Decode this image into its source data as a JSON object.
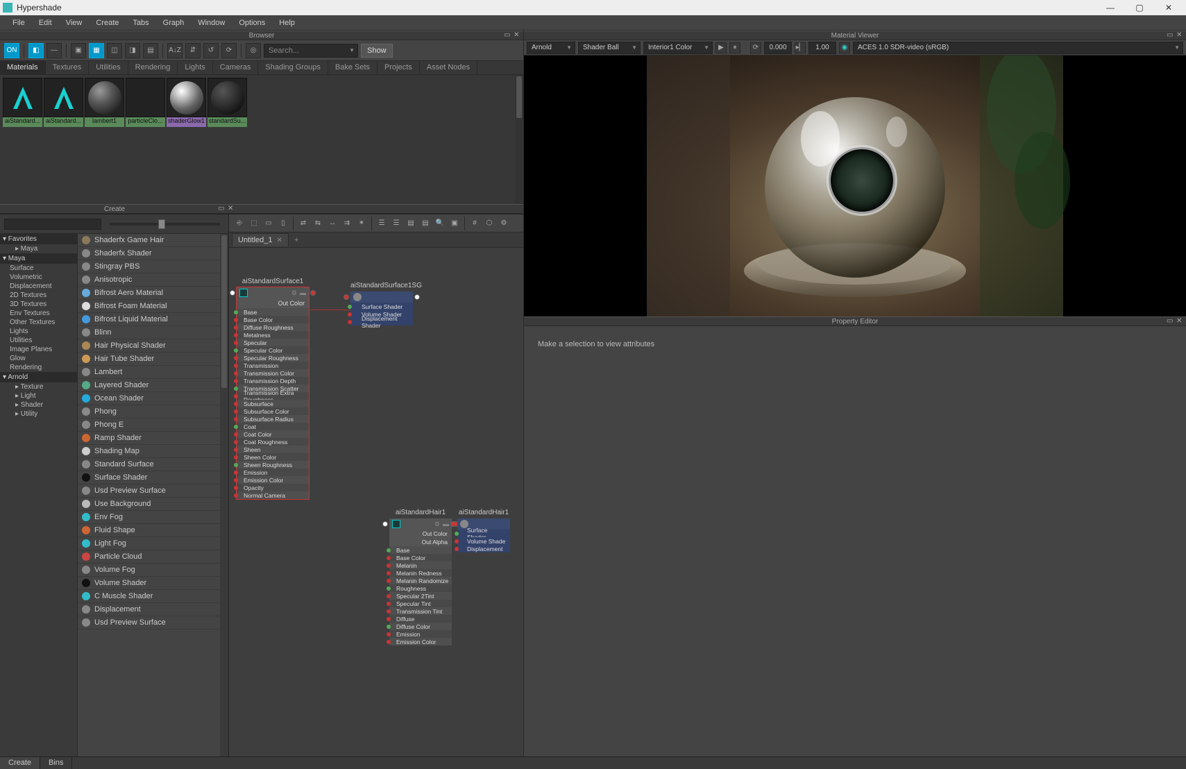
{
  "window": {
    "title": "Hypershade"
  },
  "menubar": [
    "File",
    "Edit",
    "View",
    "Create",
    "Tabs",
    "Graph",
    "Window",
    "Options",
    "Help"
  ],
  "panels": {
    "browser_title": "Browser",
    "create_title": "Create",
    "viewer_title": "Material Viewer",
    "property_title": "Property Editor"
  },
  "browser": {
    "search_placeholder": "Search...",
    "show_btn": "Show",
    "tabs": [
      "Materials",
      "Textures",
      "Utilities",
      "Rendering",
      "Lights",
      "Cameras",
      "Shading Groups",
      "Bake Sets",
      "Projects",
      "Asset Nodes"
    ],
    "active_tab": 0,
    "swatches": [
      {
        "label": "aiStandard...",
        "kind": "arnold"
      },
      {
        "label": "aiStandard...",
        "kind": "arnold"
      },
      {
        "label": "lambert1",
        "kind": "sphere"
      },
      {
        "label": "particleClo...",
        "kind": "checker"
      },
      {
        "label": "shaderGlow1",
        "kind": "glass",
        "selected": true
      },
      {
        "label": "standardSu...",
        "kind": "dark"
      }
    ]
  },
  "create": {
    "categories": [
      {
        "type": "hdr",
        "label": "Favorites"
      },
      {
        "type": "item",
        "label": "Maya",
        "indent": 1,
        "arrow": true
      },
      {
        "type": "hdr",
        "label": "Maya"
      },
      {
        "type": "item",
        "label": "Surface"
      },
      {
        "type": "item",
        "label": "Volumetric"
      },
      {
        "type": "item",
        "label": "Displacement"
      },
      {
        "type": "item",
        "label": "2D Textures"
      },
      {
        "type": "item",
        "label": "3D Textures"
      },
      {
        "type": "item",
        "label": "Env Textures"
      },
      {
        "type": "item",
        "label": "Other Textures"
      },
      {
        "type": "item",
        "label": "Lights"
      },
      {
        "type": "item",
        "label": "Utilities"
      },
      {
        "type": "item",
        "label": "Image Planes"
      },
      {
        "type": "item",
        "label": "Glow"
      },
      {
        "type": "item",
        "label": "Rendering"
      },
      {
        "type": "hdr",
        "label": "Arnold"
      },
      {
        "type": "item",
        "label": "Texture",
        "indent": 1,
        "arrow": true
      },
      {
        "type": "item",
        "label": "Light",
        "indent": 1,
        "arrow": true
      },
      {
        "type": "item",
        "label": "Shader",
        "indent": 1,
        "arrow": true
      },
      {
        "type": "item",
        "label": "Utility",
        "indent": 1,
        "arrow": true
      }
    ],
    "shaders": [
      {
        "label": "Shaderfx Game Hair",
        "color": "#8a7a5a"
      },
      {
        "label": "Shaderfx Shader",
        "color": "#888"
      },
      {
        "label": "Stingray PBS",
        "color": "#888"
      },
      {
        "label": "Anisotropic",
        "color": "#888"
      },
      {
        "label": "Bifrost Aero Material",
        "color": "#6ad"
      },
      {
        "label": "Bifrost Foam Material",
        "color": "#ddd"
      },
      {
        "label": "Bifrost Liquid Material",
        "color": "#49d"
      },
      {
        "label": "Blinn",
        "color": "#888"
      },
      {
        "label": "Hair Physical Shader",
        "color": "#a85"
      },
      {
        "label": "Hair Tube Shader",
        "color": "#c95"
      },
      {
        "label": "Lambert",
        "color": "#888"
      },
      {
        "label": "Layered Shader",
        "color": "#5a8"
      },
      {
        "label": "Ocean Shader",
        "color": "#2ad"
      },
      {
        "label": "Phong",
        "color": "#888"
      },
      {
        "label": "Phong E",
        "color": "#888"
      },
      {
        "label": "Ramp Shader",
        "color": "#c63"
      },
      {
        "label": "Shading Map",
        "color": "#ccc"
      },
      {
        "label": "Standard Surface",
        "color": "#888"
      },
      {
        "label": "Surface Shader",
        "color": "#111"
      },
      {
        "label": "Usd Preview Surface",
        "color": "#888"
      },
      {
        "label": "Use Background",
        "color": "#bbb"
      },
      {
        "label": "Env Fog",
        "color": "#3bc"
      },
      {
        "label": "Fluid Shape",
        "color": "#c63"
      },
      {
        "label": "Light Fog",
        "color": "#3bc"
      },
      {
        "label": "Particle Cloud",
        "color": "#c44"
      },
      {
        "label": "Volume Fog",
        "color": "#888"
      },
      {
        "label": "Volume Shader",
        "color": "#111"
      },
      {
        "label": "C Muscle Shader",
        "color": "#3bc"
      },
      {
        "label": "Displacement",
        "color": "#888"
      },
      {
        "label": "Usd Preview Surface",
        "color": "#888"
      }
    ]
  },
  "graph": {
    "tab_name": "Untitled_1",
    "node1": {
      "title": "aiStandardSurface1",
      "out": "Out Color",
      "attrs": [
        "Base",
        "Base Color",
        "Diffuse Roughness",
        "Metalness",
        "Specular",
        "Specular Color",
        "Specular Roughness",
        "Transmission",
        "Transmission Color",
        "Transmission Depth",
        "Transmission Scatter",
        "Transmission Extra Roughness",
        "Subsurface",
        "Subsurface Color",
        "Subsurface Radius",
        "Coat",
        "Coat Color",
        "Coat Roughness",
        "Sheen",
        "Sheen Color",
        "Sheen Roughness",
        "Emission",
        "Emission Color",
        "Opacity",
        "Normal Camera"
      ]
    },
    "node2": {
      "title": "aiStandardSurface1SG",
      "attrs": [
        "Surface Shader",
        "Volume Shader",
        "Displacement Shader"
      ]
    },
    "node3": {
      "title": "aiStandardHair1",
      "outs": [
        "Out Color",
        "Out Alpha"
      ],
      "attrs": [
        "Base",
        "Base Color",
        "Melanin",
        "Melanin Redness",
        "Melanin Randomize",
        "Roughness",
        "Specular 2Tint",
        "Specular Tint",
        "Transmission Tint",
        "Diffuse",
        "Diffuse Color",
        "Emission",
        "Emission Color"
      ]
    },
    "node4": {
      "title": "aiStandardHair1",
      "attrs": [
        "Surface Shader",
        "Volume Shade",
        "Displacement "
      ]
    }
  },
  "viewer": {
    "renderer": "Arnold",
    "geometry": "Shader Ball",
    "environment": "Interior1 Color",
    "val1": "0.000",
    "val2": "1.00",
    "colorspace": "ACES 1.0 SDR-video (sRGB)"
  },
  "property": {
    "message": "Make a selection to view attributes"
  },
  "bottom_tabs": [
    "Create",
    "Bins"
  ]
}
